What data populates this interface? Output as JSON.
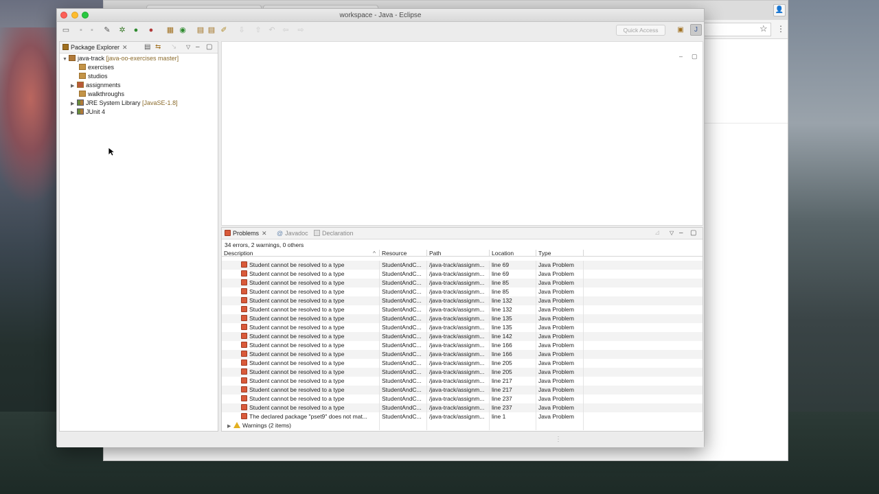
{
  "eclipse": {
    "title": "workspace - Java - Eclipse",
    "quick_access_placeholder": "Quick Access"
  },
  "package_explorer": {
    "tab_label": "Package Explorer",
    "tree": [
      {
        "label": "java-track",
        "decoration": "[java-oo-exercises master]",
        "icon": "project-icon",
        "expanded": true,
        "depth": 0
      },
      {
        "label": "exercises",
        "decoration": "",
        "icon": "package-folder-icon",
        "depth": 1
      },
      {
        "label": "studios",
        "decoration": "",
        "icon": "package-folder-icon",
        "depth": 1
      },
      {
        "label": "assignments",
        "decoration": "",
        "icon": "package-folder-icon",
        "collapsed": true,
        "depth": 1
      },
      {
        "label": "walkthroughs",
        "decoration": "",
        "icon": "package-folder-icon",
        "depth": 1
      },
      {
        "label": "JRE System Library",
        "decoration": "[JavaSE-1.8]",
        "icon": "library-icon",
        "collapsed": true,
        "depth": 1
      },
      {
        "label": "JUnit 4",
        "decoration": "",
        "icon": "library-icon",
        "collapsed": true,
        "depth": 1
      }
    ]
  },
  "problems": {
    "tabs": [
      {
        "label": "Problems",
        "active": true
      },
      {
        "label": "Javadoc",
        "active": false
      },
      {
        "label": "Declaration",
        "active": false
      }
    ],
    "summary": "34 errors, 2 warnings, 0 others",
    "columns": [
      "Description",
      "Resource",
      "Path",
      "Location",
      "Type"
    ],
    "rows": [
      {
        "description": "Student cannot be resolved to a type",
        "resource": "StudentAndC...",
        "path": "/java-track/assignm...",
        "location": "line 69",
        "type": "Java Problem"
      },
      {
        "description": "Student cannot be resolved to a type",
        "resource": "StudentAndC...",
        "path": "/java-track/assignm...",
        "location": "line 69",
        "type": "Java Problem"
      },
      {
        "description": "Student cannot be resolved to a type",
        "resource": "StudentAndC...",
        "path": "/java-track/assignm...",
        "location": "line 85",
        "type": "Java Problem"
      },
      {
        "description": "Student cannot be resolved to a type",
        "resource": "StudentAndC...",
        "path": "/java-track/assignm...",
        "location": "line 85",
        "type": "Java Problem"
      },
      {
        "description": "Student cannot be resolved to a type",
        "resource": "StudentAndC...",
        "path": "/java-track/assignm...",
        "location": "line 132",
        "type": "Java Problem"
      },
      {
        "description": "Student cannot be resolved to a type",
        "resource": "StudentAndC...",
        "path": "/java-track/assignm...",
        "location": "line 132",
        "type": "Java Problem"
      },
      {
        "description": "Student cannot be resolved to a type",
        "resource": "StudentAndC...",
        "path": "/java-track/assignm...",
        "location": "line 135",
        "type": "Java Problem"
      },
      {
        "description": "Student cannot be resolved to a type",
        "resource": "StudentAndC...",
        "path": "/java-track/assignm...",
        "location": "line 135",
        "type": "Java Problem"
      },
      {
        "description": "Student cannot be resolved to a type",
        "resource": "StudentAndC...",
        "path": "/java-track/assignm...",
        "location": "line 142",
        "type": "Java Problem"
      },
      {
        "description": "Student cannot be resolved to a type",
        "resource": "StudentAndC...",
        "path": "/java-track/assignm...",
        "location": "line 166",
        "type": "Java Problem"
      },
      {
        "description": "Student cannot be resolved to a type",
        "resource": "StudentAndC...",
        "path": "/java-track/assignm...",
        "location": "line 166",
        "type": "Java Problem"
      },
      {
        "description": "Student cannot be resolved to a type",
        "resource": "StudentAndC...",
        "path": "/java-track/assignm...",
        "location": "line 205",
        "type": "Java Problem"
      },
      {
        "description": "Student cannot be resolved to a type",
        "resource": "StudentAndC...",
        "path": "/java-track/assignm...",
        "location": "line 205",
        "type": "Java Problem"
      },
      {
        "description": "Student cannot be resolved to a type",
        "resource": "StudentAndC...",
        "path": "/java-track/assignm...",
        "location": "line 217",
        "type": "Java Problem"
      },
      {
        "description": "Student cannot be resolved to a type",
        "resource": "StudentAndC...",
        "path": "/java-track/assignm...",
        "location": "line 217",
        "type": "Java Problem"
      },
      {
        "description": "Student cannot be resolved to a type",
        "resource": "StudentAndC...",
        "path": "/java-track/assignm...",
        "location": "line 237",
        "type": "Java Problem"
      },
      {
        "description": "Student cannot be resolved to a type",
        "resource": "StudentAndC...",
        "path": "/java-track/assignm...",
        "location": "line 237",
        "type": "Java Problem"
      },
      {
        "description": "The declared package \"pset9\" does not mat...",
        "resource": "StudentAndC...",
        "path": "/java-track/assignm...",
        "location": "line 1",
        "type": "Java Problem"
      }
    ],
    "warnings_group": "Warnings (2 items)"
  },
  "colors": {
    "error": "#d95a3a",
    "warning": "#e3b021",
    "decoration": "#8a6a2a",
    "selection_bg": "#f3f3f3"
  }
}
